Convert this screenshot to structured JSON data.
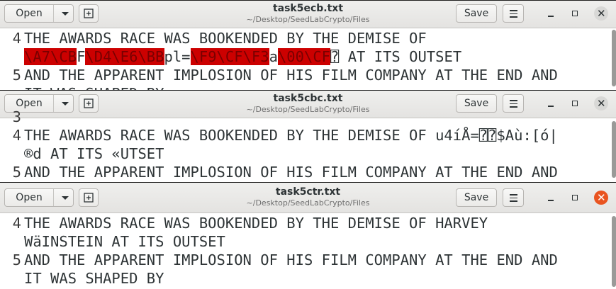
{
  "windows": [
    {
      "file": "task5ecb.txt",
      "path": "~/Desktop/SeedLabCrypto/Files",
      "open_label": "Open",
      "save_label": "Save",
      "line_numbers": [
        "4",
        "",
        "5",
        ""
      ],
      "lines": {
        "l1": "THE AWARDS RACE WAS BOOKENDED BY THE DEMISE OF",
        "l2_seg1": "\\A7\\CB",
        "l2_seg2": "F",
        "l2_seg3": "\\D4\\E6\\BB",
        "l2_seg4": "pl=",
        "l2_seg5": "\\F9\\CF\\F3",
        "l2_seg6": "a",
        "l2_seg7": "\\00\\CF",
        "l2_seg8": "⍰ AT ITS OUTSET",
        "l3": "AND THE APPARENT IMPLOSION OF HIS FILM COMPANY AT THE END AND",
        "l4": "IT WAS SHAPED BY"
      }
    },
    {
      "file": "task5cbc.txt",
      "path": "~/Desktop/SeedLabCrypto/Files",
      "open_label": "Open",
      "save_label": "Save",
      "line_numbers": [
        "3",
        "4",
        "",
        "5"
      ],
      "lines": {
        "l1": "THE AWARDS RACE WAS BOOKENDED BY THE DEMISE OF u4íÅ=⍰⍰$Aù:[ó|",
        "l2": "®d AT ITS «UTSET",
        "l3": "AND THE APPARENT IMPLOSION OF HIS FILM COMPANY AT THE END AND"
      }
    },
    {
      "file": "task5ctr.txt",
      "path": "~/Desktop/SeedLabCrypto/Files",
      "open_label": "Open",
      "save_label": "Save",
      "line_numbers": [
        "4",
        "",
        "5",
        ""
      ],
      "lines": {
        "l1": "THE AWARDS RACE WAS BOOKENDED BY THE DEMISE OF HARVEY",
        "l2": "WäINSTEIN AT ITS OUTSET",
        "l3": "AND THE APPARENT IMPLOSION OF HIS FILM COMPANY AT THE END AND",
        "l4": "IT WAS SHAPED BY"
      }
    }
  ],
  "icons": {
    "open_dropdown": "chevron-down-icon",
    "new_document": "new-document-icon",
    "menu": "hamburger-menu-icon",
    "minimize": "minimize-icon",
    "maximize": "maximize-icon",
    "close": "close-icon"
  },
  "colors": {
    "highlight": "#cc0000",
    "active_close": "#e95420"
  }
}
